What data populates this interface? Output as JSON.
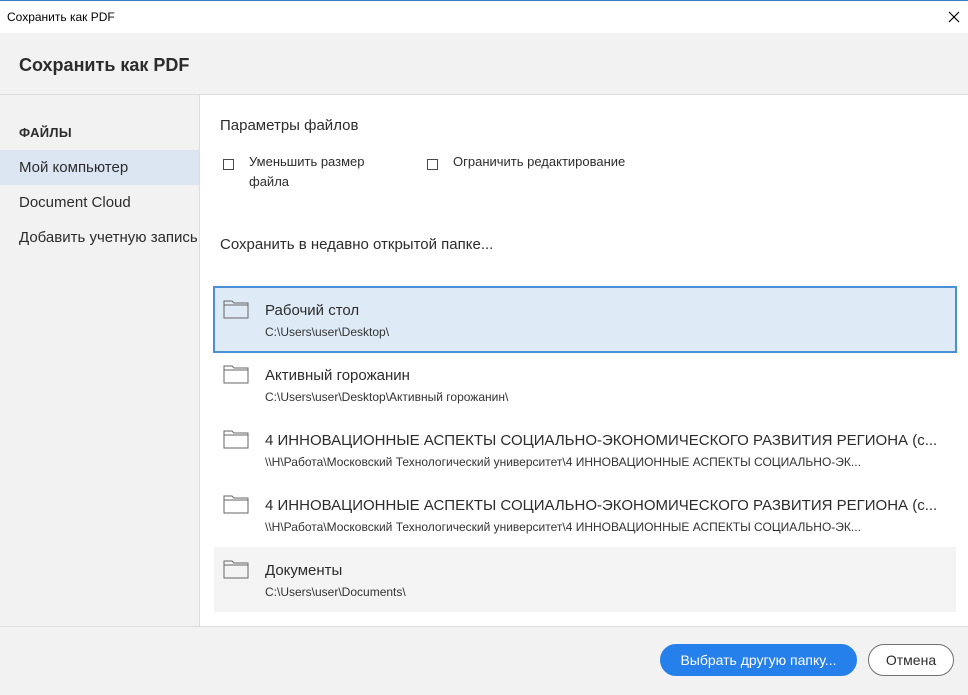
{
  "window": {
    "title": "Сохранить как PDF"
  },
  "header": {
    "heading": "Сохранить как PDF"
  },
  "sidebar": {
    "section_label": "ФАЙЛЫ",
    "items": [
      {
        "label": "Мой компьютер",
        "selected": true
      },
      {
        "label": "Document Cloud",
        "selected": false
      },
      {
        "label": "Добавить учетную запись",
        "selected": false
      }
    ]
  },
  "params": {
    "title": "Параметры файлов",
    "reduce_size": {
      "label": "Уменьшить размер файла",
      "checked": false
    },
    "restrict_editing": {
      "label": "Ограничить редактирование",
      "checked": false
    }
  },
  "recent": {
    "title": "Сохранить в недавно открытой папке...",
    "folders": [
      {
        "name": "Рабочий стол",
        "path": "C:\\Users\\user\\Desktop\\",
        "state": "selected"
      },
      {
        "name": "Активный горожанин",
        "path": "C:\\Users\\user\\Desktop\\Активный горожанин\\",
        "state": "normal"
      },
      {
        "name": "4 ИННОВАЦИОННЫЕ АСПЕКТЫ СОЦИАЛЬНО-ЭКОНОМИЧЕСКОГО РАЗВИТИЯ РЕГИОНА (с...",
        "path": "\\\\Н\\Работа\\Московский Технологический университет\\4 ИННОВАЦИОННЫЕ АСПЕКТЫ СОЦИАЛЬНО-ЭК...",
        "state": "normal"
      },
      {
        "name": "4 ИННОВАЦИОННЫЕ АСПЕКТЫ СОЦИАЛЬНО-ЭКОНОМИЧЕСКОГО РАЗВИТИЯ РЕГИОНА (с...",
        "path": "\\\\Н\\Работа\\Московский Технологический университет\\4 ИННОВАЦИОННЫЕ АСПЕКТЫ СОЦИАЛЬНО-ЭК...",
        "state": "normal"
      },
      {
        "name": "Документы",
        "path": "C:\\Users\\user\\Documents\\",
        "state": "hover"
      }
    ]
  },
  "footer": {
    "choose_folder_label": "Выбрать другую папку...",
    "cancel_label": "Отмена"
  },
  "colors": {
    "accent": "#2680eb",
    "selection_bg": "#deebf7",
    "selection_border": "#4a90d9",
    "sidebar_selected": "#dce6f2"
  },
  "icons": {
    "close": "close-icon",
    "folder": "folder-icon",
    "checkbox": "checkbox-icon"
  }
}
